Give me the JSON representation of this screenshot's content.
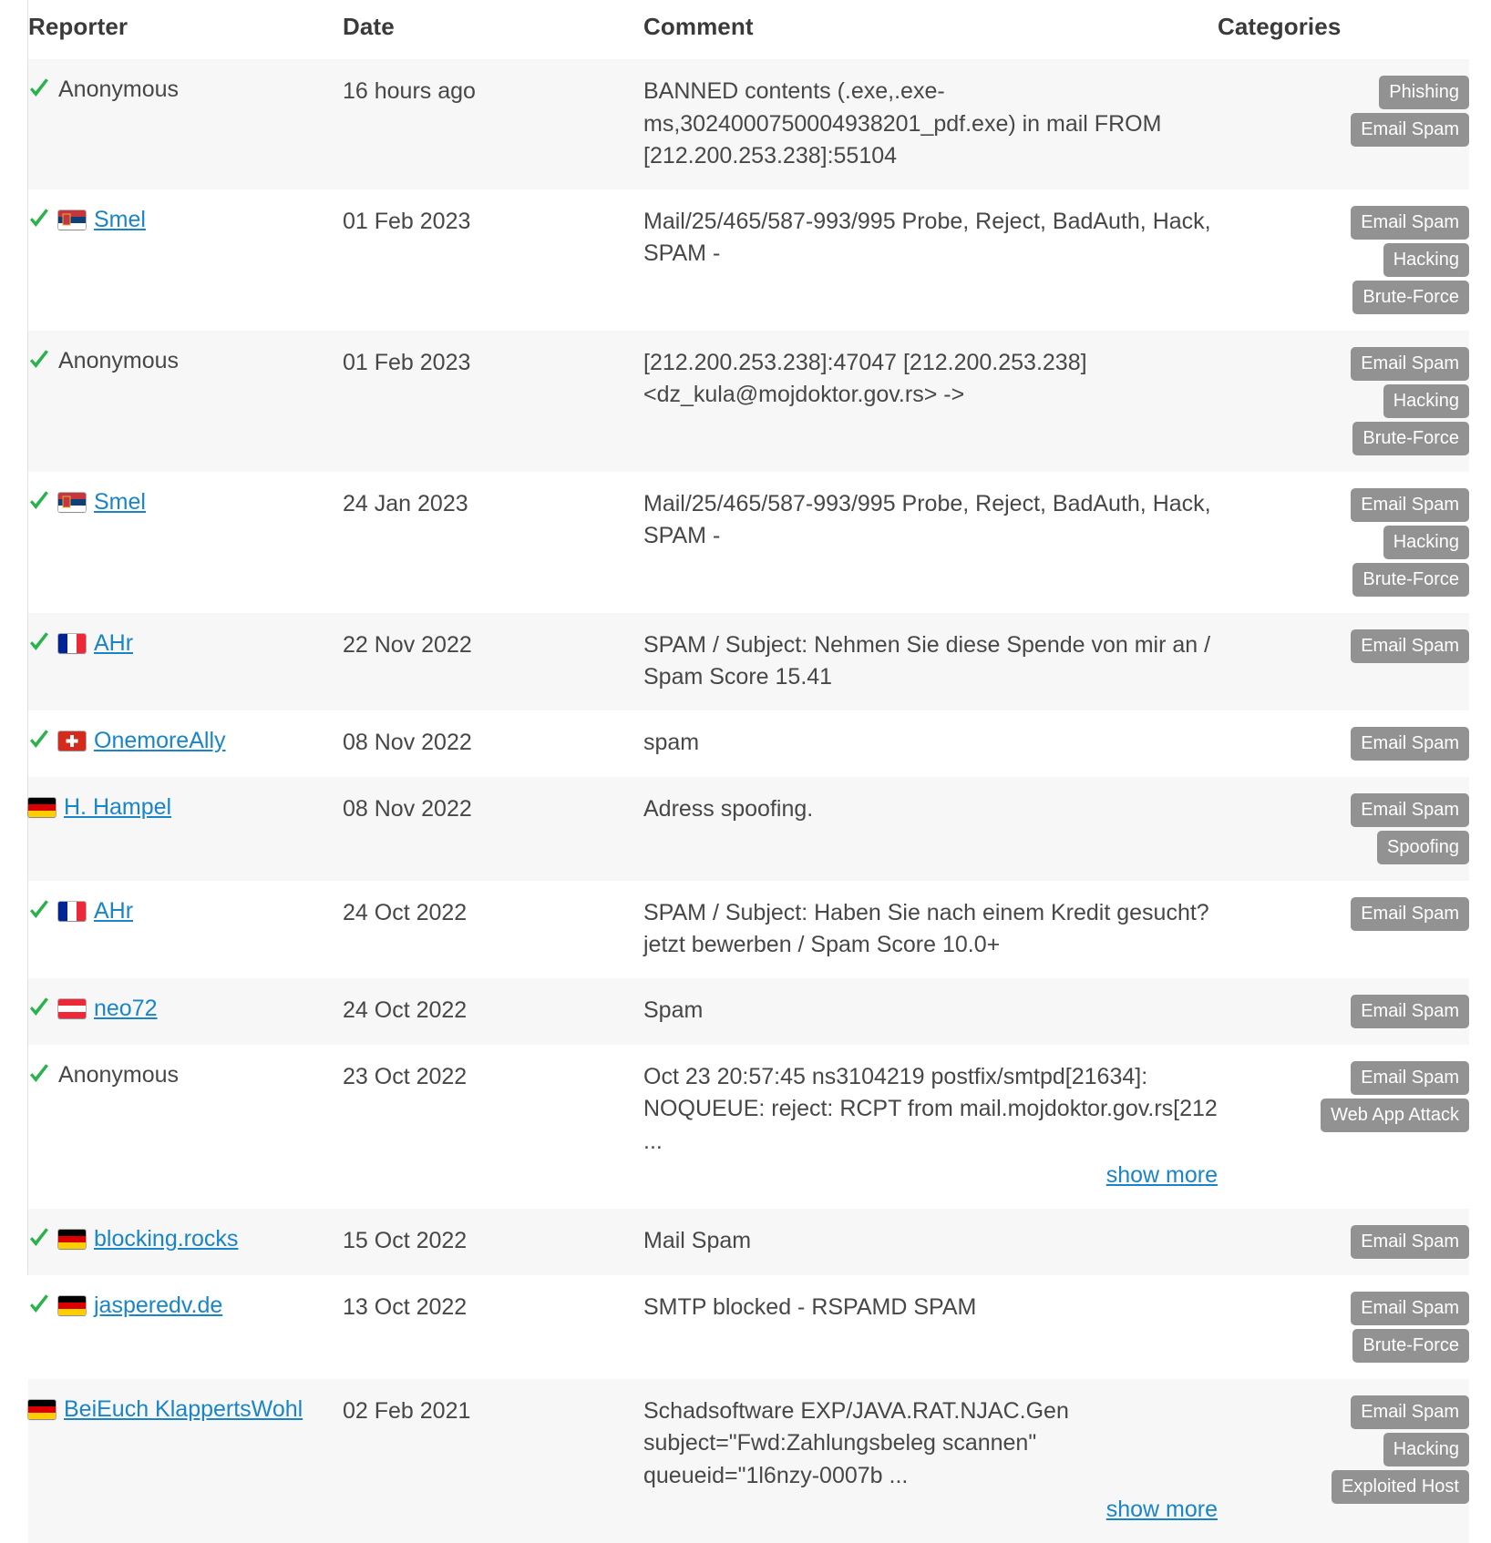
{
  "table": {
    "columns": [
      {
        "key": "reporter",
        "label": "Reporter"
      },
      {
        "key": "date",
        "label": "Date"
      },
      {
        "key": "comment",
        "label": "Comment"
      },
      {
        "key": "categories",
        "label": "Categories"
      }
    ],
    "show_more_label": "show more",
    "anonymous_label": "Anonymous",
    "badge_color": "#929292",
    "link_color": "#1a85c6",
    "check_color": "#2bb24c",
    "rows": [
      {
        "verified": true,
        "flag": null,
        "reporter": "Anonymous",
        "reporter_is_link": false,
        "date": "16 hours ago",
        "comment": "BANNED contents (.exe,.exe-ms,3024000750004938201_pdf.exe) in mail FROM [212.200.253.238]:55104",
        "show_more": false,
        "categories": [
          "Phishing",
          "Email Spam"
        ]
      },
      {
        "verified": true,
        "flag": "rs",
        "reporter": "Smel",
        "reporter_is_link": true,
        "date": "01 Feb 2023",
        "comment": "Mail/25/465/587-993/995 Probe, Reject, BadAuth, Hack, SPAM -",
        "show_more": false,
        "categories": [
          "Email Spam",
          "Hacking",
          "Brute-Force"
        ]
      },
      {
        "verified": true,
        "flag": null,
        "reporter": "Anonymous",
        "reporter_is_link": false,
        "date": "01 Feb 2023",
        "comment": "[212.200.253.238]:47047 [212.200.253.238] <dz_kula@mojdoktor.gov.rs> ->",
        "show_more": false,
        "categories": [
          "Email Spam",
          "Hacking",
          "Brute-Force"
        ]
      },
      {
        "verified": true,
        "flag": "rs",
        "reporter": "Smel",
        "reporter_is_link": true,
        "date": "24 Jan 2023",
        "comment": "Mail/25/465/587-993/995 Probe, Reject, BadAuth, Hack, SPAM -",
        "show_more": false,
        "categories": [
          "Email Spam",
          "Hacking",
          "Brute-Force"
        ]
      },
      {
        "verified": true,
        "flag": "fr",
        "reporter": "AHr",
        "reporter_is_link": true,
        "date": "22 Nov 2022",
        "comment": "SPAM / Subject: Nehmen Sie diese Spende von mir an / Spam Score 15.41",
        "show_more": false,
        "categories": [
          "Email Spam"
        ]
      },
      {
        "verified": true,
        "flag": "ch",
        "reporter": "OnemoreAlly",
        "reporter_is_link": true,
        "date": "08 Nov 2022",
        "comment": "spam",
        "show_more": false,
        "categories": [
          "Email Spam"
        ]
      },
      {
        "verified": false,
        "flag": "de",
        "reporter": "H. Hampel",
        "reporter_is_link": true,
        "date": "08 Nov 2022",
        "comment": "Adress spoofing.",
        "show_more": false,
        "categories": [
          "Email Spam",
          "Spoofing"
        ]
      },
      {
        "verified": true,
        "flag": "fr",
        "reporter": "AHr",
        "reporter_is_link": true,
        "date": "24 Oct 2022",
        "comment": "SPAM / Subject: Haben Sie nach einem Kredit gesucht? jetzt bewerben / Spam Score 10.0+",
        "show_more": false,
        "categories": [
          "Email Spam"
        ]
      },
      {
        "verified": true,
        "flag": "at",
        "reporter": "neo72",
        "reporter_is_link": true,
        "date": "24 Oct 2022",
        "comment": "Spam",
        "show_more": false,
        "categories": [
          "Email Spam"
        ]
      },
      {
        "verified": true,
        "flag": null,
        "reporter": "Anonymous",
        "reporter_is_link": false,
        "date": "23 Oct 2022",
        "comment": "Oct 23 20:57:45 ns3104219 postfix/smtpd[21634]: NOQUEUE: reject: RCPT from mail.mojdoktor.gov.rs[212 ...",
        "show_more": true,
        "categories": [
          "Email Spam",
          "Web App Attack"
        ]
      },
      {
        "verified": true,
        "flag": "de",
        "reporter": "blocking.rocks",
        "reporter_is_link": true,
        "date": "15 Oct 2022",
        "comment": "Mail Spam",
        "show_more": false,
        "categories": [
          "Email Spam"
        ]
      },
      {
        "verified": true,
        "flag": "de",
        "reporter": "jasperedv.de",
        "reporter_is_link": true,
        "date": "13 Oct 2022",
        "comment": "SMTP blocked - RSPAMD SPAM",
        "show_more": false,
        "categories": [
          "Email Spam",
          "Brute-Force"
        ]
      },
      {
        "verified": false,
        "flag": "de",
        "reporter": "BeiEuch KlappertsWohl",
        "reporter_is_link": true,
        "date": "02 Feb 2021",
        "comment": "Schadsoftware EXP/JAVA.RAT.NJAC.Gen subject=\"Fwd:Zahlungsbeleg scannen\" queueid=\"1l6nzy-0007b ...",
        "show_more": true,
        "categories": [
          "Email Spam",
          "Hacking",
          "Exploited Host"
        ]
      }
    ]
  }
}
